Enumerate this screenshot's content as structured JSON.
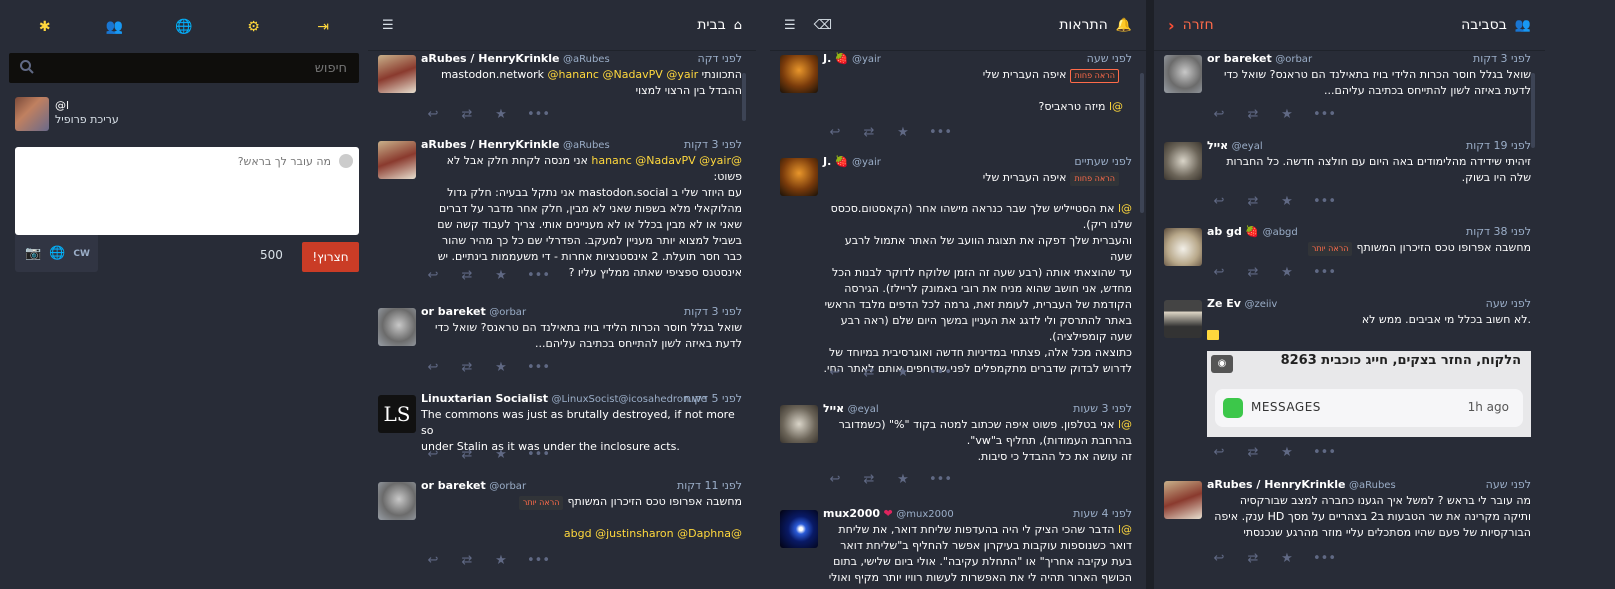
{
  "drawer": {
    "nav": [
      "✱",
      "👥",
      "🌐",
      "⚙",
      "⇥"
    ],
    "search_placeholder": "חיפוש",
    "profile_handle": "@l",
    "profile_edit": "עריכת פרופיל",
    "compose_placeholder": "מה עובר לך בראש?",
    "counter": "500",
    "toot": "!חצרוץ",
    "cw": "CW"
  },
  "columns": {
    "home": {
      "title": "בבית"
    },
    "notifications": {
      "title": "התראות"
    },
    "local": {
      "title": "בסביבה",
      "back": "חזרה"
    }
  },
  "home": [
    {
      "name": "aRubes / HenryKrinkle",
      "acct": "@aRubes",
      "time": "לפני דקה",
      "l1": "התכוונתי mastodon.network ",
      "l1m": "@hananc @NadavPV @yair",
      "l2": "ההבדל בין הרצוי למצוי"
    },
    {
      "name": "aRubes / HenryKrinkle",
      "acct": "@aRubes",
      "time": "לפני 3 דקות",
      "l1m": "@hananc @NadavPV @yair",
      "l1": " אני מנסה לקחת חלק אבל לא פשוט:",
      "l2": "עם היוזר שלי ב mastodon.social אני נתקל בבעיה: חלק גדול",
      "l3": "מהלוקאלי מלא בשפות שאני לא מבין, חלק אחר מדבר על דברים",
      "l4": "שאני או לא מבין בכלל או לא מעניינים אותי. צריך לעבוד קשה שם",
      "l5": "בשביל למצוא יותר מעניין למעקב. הפדרלי שם כל כך מהיר שהור",
      "l6": "כבר חסר תועלת. 2 אינסטנציות אחרות - די משעממות בינתיים.  יש",
      "l7": "אינסטנס ספציפי שאתה ממליץ עליו ?"
    },
    {
      "name": "or bareket",
      "acct": "@orbar",
      "time": "לפני 3 דקות",
      "l1": "שואל בגלל חוסר הכרות הלידי בויז בתאילנד הם טראנס? שואל כדי",
      "l2": "לדעת באיזה לשון להתייחס בכתיבה עליהם..."
    },
    {
      "name": "Linuxtarian Socialist",
      "acct": "@LinuxSocist@icosahedron.we",
      "time": "לפני 5 דקות",
      "l1": "The commons was just as brutally destroyed, if not more so",
      "l2": "under Stalin as it was under the inclosure acts."
    },
    {
      "name": "or bareket",
      "acct": "@orbar",
      "time": "לפני 11 דקות",
      "l1": "מחשבה אפרופו טכס הזיכרון המשותף",
      "badge": "הראה יותר",
      "l2m": "@abgd @justinsharon @Daphna"
    }
  ],
  "notifications": [
    {
      "name": "J.",
      "acct": "@yair",
      "time": "לפני שעה",
      "l1": "איפה העברית שלי",
      "badge": "הראה פחות",
      "l2m": "@l",
      "l2": " מיזה טראביס?"
    },
    {
      "name": "J.",
      "acct": "@yair",
      "time": "לפני שעתיים",
      "l1": "איפה העברית שלי",
      "badge": "הראה פחות",
      "p1": "את הסטייליש שלך שבר כנראה מישהו אחר (הקאסטום.סכסס",
      "p2": "שלנו ריק).",
      "p3": "והעברית שלך דפקה את תצוגת הוועב של האתר אתמול לרבע שעה",
      "p4": "עד שהוצאתי אותה (רבע שעה זה הזמן שלוקח לדוקר לבנות הכל",
      "p5": "מחדש, אני חושב שהוא מניח את רובי באמונק לריילז). הגירסה",
      "p6": "הקודמת של העברית, לעומת זאת, גרמה לכל הדפים מלבד הראשי",
      "p7": "באתר להתרסק ולי לדגג את העניין במשך היום שלם (ראה רבע",
      "p8": "שעה קומפילציה).",
      "p9": "כתוצאה מכל אלה, פצתחי במדיניות חדשה ואוגרסיבית במיוחד של",
      "p10": "לדרוש לבדוק שדברים מתקמפלים לפני שדוחפים אותם לאתר החי."
    },
    {
      "name": "אייל",
      "acct": "@eyal",
      "time": "לפני 3 שעות",
      "l1m": "@l",
      "l1": " אני בטלפון. פשוט איפה שכתוב למטה בקוד \"%\" (כשמדובר",
      "l2": "בהרחבת העמודות), תחליף ב\"vw\".",
      "l3": "זה עושה את כל ההבדל כי סיבות."
    },
    {
      "name": "mux2000",
      "acct": "@mux2000",
      "time": "לפני 4 שעות",
      "l1m": "@l",
      "l1": " הדבר שהכי הציק לי היה בהעדפות שליחת דואר, את שליחת",
      "l2": "דואר כשנוספות עוקבות בעיקרון אפשר להחליף ב\"שליחת דואר",
      "l3": "בעת עקיבה אחריך\" או \"התחלת עקיבה\". אולי ביום שלישי, בתום",
      "l4": "הכושף הארור תהיה לי את האפשרות לעשות רוויו יותר מקיף ואולי"
    }
  ],
  "local": [
    {
      "name": "or bareket",
      "acct": "@orbar",
      "time": "לפני 3 דקות",
      "l1": "שואל בגלל חוסר הכרות הלידי בויז בתאילנד הם טראנס? שואל כדי",
      "l2": "לדעת באיזה לשון להתייחס בכתיבה עליהם..."
    },
    {
      "name": "אייל",
      "acct": "@eyal",
      "time": "לפני 19 דקות",
      "l1": "זיהיתי שידידה מהלימודים באה היום עם חולצה חדשה. כל החברות",
      "l2": "שלה היו בשוק."
    },
    {
      "name": "ab gd",
      "acct": "@abgd",
      "time": "לפני 38 דקות",
      "l1": "מחשבה אפרופו טכס הזיכרון המשותף",
      "badge": "הראה יותר"
    },
    {
      "name": "Ze Ev",
      "acct": "@zeiiv",
      "time": "לפני שעה",
      "l1": ".לא חשוב בכלל מי אביבים. ממש לא",
      "img_text": "הלקוח, החזר בצקים, חייג כוכבית 8263",
      "img_app": "MESSAGES",
      "img_time": "1h ago"
    },
    {
      "name": "aRubes / HenryKrinkle",
      "acct": "@aRubes",
      "time": "לפני שעה",
      "l1": "מה עובר לי בראש ? למשל איך הגענו כחברה למצב שבורקסיה",
      "l2": "ותיקה מקרינה את שר הטבעות ב2 בצהריים על מסך HD ענק. איפה",
      "l3": "הבורקסיות של פעם שהיו מסתכלים עליי מוזר מהרגע שנכנסתי"
    }
  ],
  "colors": {
    "accent": "#ffd83d",
    "danger": "#ca3c26",
    "bg": "#282c37"
  }
}
